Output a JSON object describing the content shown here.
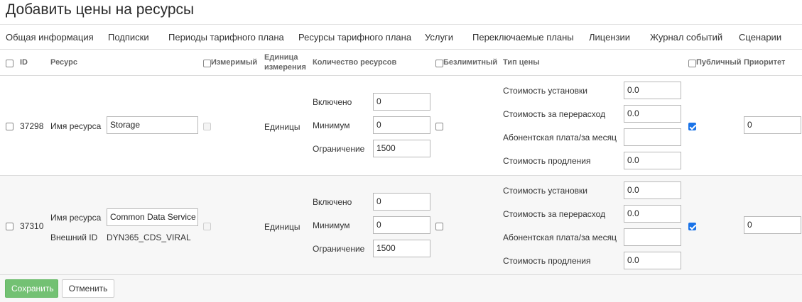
{
  "page": {
    "title": "Добавить цены на ресурсы"
  },
  "tabs": [
    {
      "label": "Общая информация"
    },
    {
      "label": "Подписки"
    },
    {
      "label": "Периоды тарифного плана"
    },
    {
      "label": "Ресурсы тарифного плана"
    },
    {
      "label": "Услуги"
    },
    {
      "label": "Переключаемые планы"
    },
    {
      "label": "Лицензии"
    },
    {
      "label": "Журнал событий"
    },
    {
      "label": "Сценарии"
    }
  ],
  "table": {
    "headers": {
      "id": "ID",
      "resource": "Ресурс",
      "measurable": "Измеримый",
      "unit_line1": "Единица",
      "unit_line2": "измерения",
      "quantity": "Количество ресурсов",
      "unlimited": "Безлимитный",
      "price_type": "Тип цены",
      "public": "Публичный",
      "priority": "Приоритет"
    },
    "rows": [
      {
        "id": "37298",
        "name_label": "Имя ресурса",
        "name_value": "Storage",
        "unit": "Единицы",
        "included_label": "Включено",
        "included_value": "0",
        "min_label": "Минимум",
        "min_value": "0",
        "limit_label": "Ограничение",
        "limit_value": "1500",
        "setup_label": "Стоимость установки",
        "setup_value": "0.0",
        "overuse_label": "Стоимость за перерасход",
        "overuse_value": "0.0",
        "monthly_label": "Абонентская плата/за месяц",
        "monthly_value": "",
        "renewal_label": "Стоимость продления",
        "renewal_value": "0.0",
        "priority_value": "0"
      },
      {
        "id": "37310",
        "name_label": "Имя ресурса",
        "name_value": "Common Data Service",
        "external_label": "Внешний ID",
        "external_value": "DYN365_CDS_VIRAL",
        "unit": "Единицы",
        "included_label": "Включено",
        "included_value": "0",
        "min_label": "Минимум",
        "min_value": "0",
        "limit_label": "Ограничение",
        "limit_value": "1500",
        "setup_label": "Стоимость установки",
        "setup_value": "0.0",
        "overuse_label": "Стоимость за перерасход",
        "overuse_value": "0.0",
        "monthly_label": "Абонентская плата/за месяц",
        "monthly_value": "",
        "renewal_label": "Стоимость продления",
        "renewal_value": "0.0",
        "priority_value": "0"
      }
    ]
  },
  "buttons": {
    "save": "Сохранить",
    "cancel": "Отменить"
  },
  "colors": {
    "save_button": "#5cb85c",
    "checkbox_checked": "#1a73e8",
    "row_alt": "#f7f7f7"
  }
}
